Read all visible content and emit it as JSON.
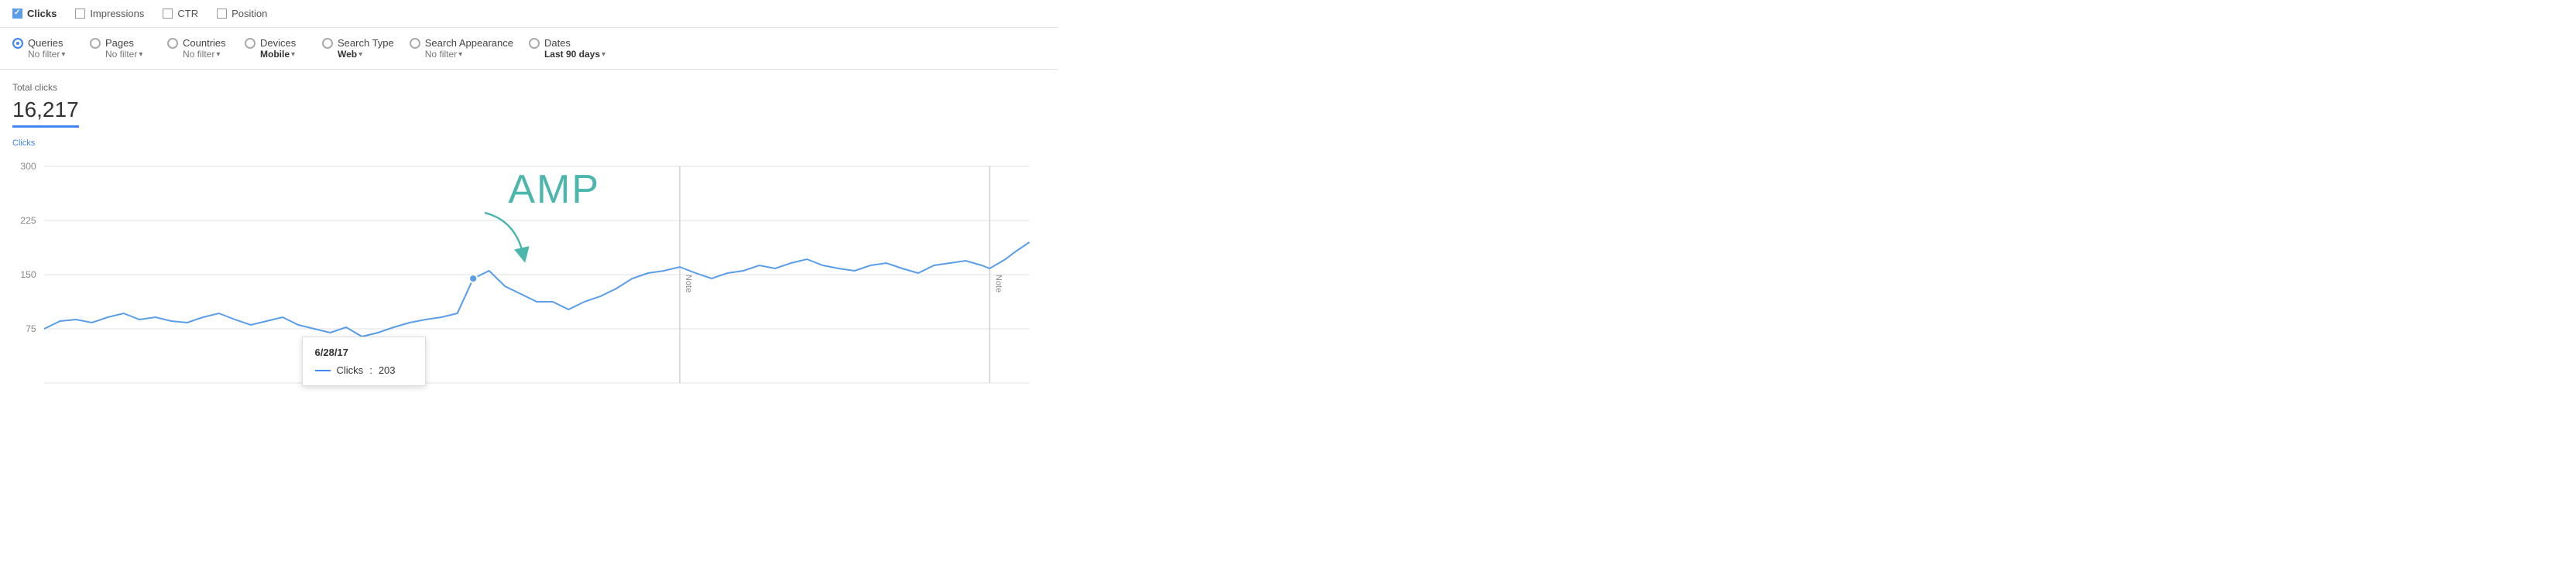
{
  "metrics": {
    "clicks": {
      "label": "Clicks",
      "checked": true
    },
    "impressions": {
      "label": "Impressions",
      "checked": false
    },
    "ctr": {
      "label": "CTR",
      "checked": false
    },
    "position": {
      "label": "Position",
      "checked": false
    }
  },
  "filters": [
    {
      "id": "queries",
      "label": "Queries",
      "sub": "No filter",
      "subBold": false,
      "active": true,
      "arrow": true
    },
    {
      "id": "pages",
      "label": "Pages",
      "sub": "No filter",
      "subBold": false,
      "active": false,
      "arrow": true
    },
    {
      "id": "countries",
      "label": "Countries",
      "sub": "No filter",
      "subBold": false,
      "active": false,
      "arrow": true
    },
    {
      "id": "devices",
      "label": "Devices",
      "sub": "Mobile",
      "subBold": true,
      "active": false,
      "arrow": true
    },
    {
      "id": "search-type",
      "label": "Search Type",
      "sub": "Web",
      "subBold": true,
      "active": false,
      "arrow": true
    },
    {
      "id": "search-appearance",
      "label": "Search Appearance",
      "sub": "No filter",
      "subBold": false,
      "active": false,
      "arrow": true
    },
    {
      "id": "dates",
      "label": "Dates",
      "sub": "Last 90 days",
      "subBold": true,
      "active": false,
      "arrow": true
    }
  ],
  "chart": {
    "total_label": "Total clicks",
    "total_value": "16,217",
    "y_axis_label": "Clicks",
    "y_ticks": [
      "300",
      "225",
      "150",
      "75"
    ],
    "amp_text": "AMP",
    "tooltip": {
      "date": "6/28/17",
      "metric_label": "Clicks",
      "metric_value": "203"
    },
    "notes": [
      "Note",
      "Note"
    ]
  }
}
